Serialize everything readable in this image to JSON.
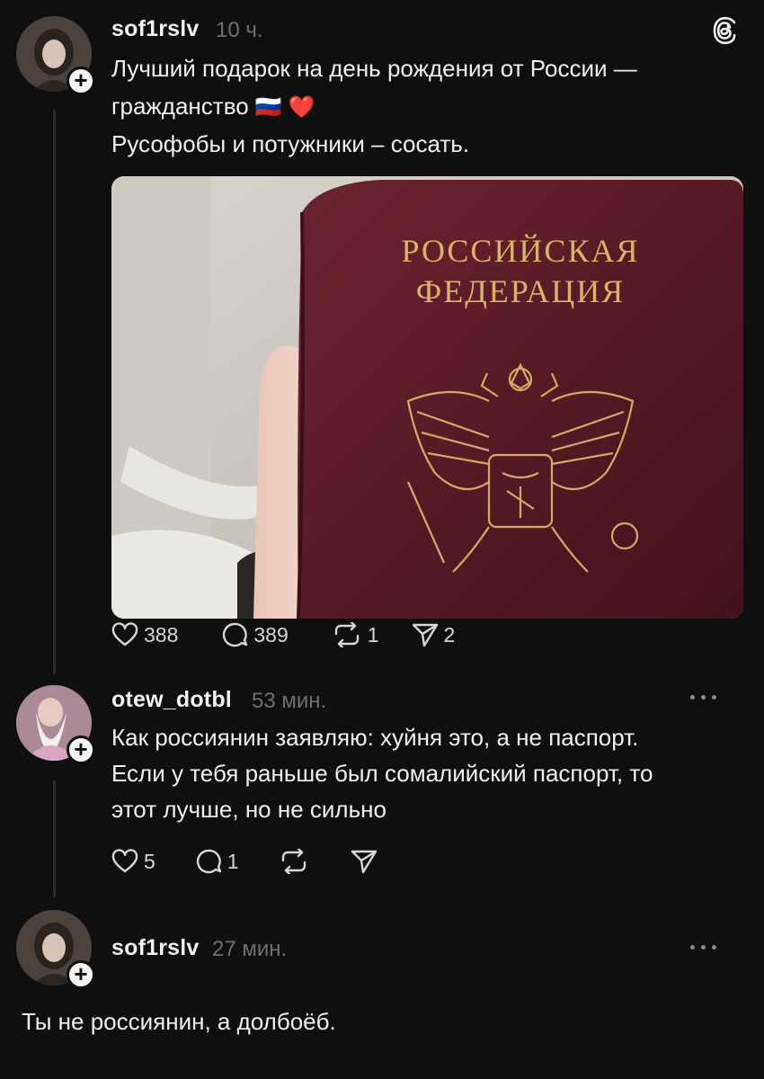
{
  "post": {
    "username": "sof1rslv",
    "time": "10 ч.",
    "line1": "Лучший подарок на день рождения от России —",
    "line2": "гражданство",
    "line2_emoji": "🇷🇺 ❤️",
    "line3": "Русофобы и потужники – сосать.",
    "image": {
      "title_line1": "РОССИЙСКАЯ",
      "title_line2": "ФЕДЕРАЦИЯ"
    },
    "stats": {
      "likes": "388",
      "comments": "389",
      "reposts": "1",
      "shares": "2"
    }
  },
  "reply1": {
    "username": "otew_dotbl",
    "time": "53 мин.",
    "line1": "Как россиянин заявляю: хуйня это, а не паспорт.",
    "line2": "Если у тебя раньше был сомалийский паспорт, то",
    "line3": "этот лучше, но не сильно",
    "stats": {
      "likes": "5",
      "comments": "1"
    }
  },
  "reply2": {
    "username": "sof1rslv",
    "time": "27 мин.",
    "text": "Ты не россиянин, а долбоёб."
  },
  "icons": {
    "app": "threads-icon",
    "like": "heart-icon",
    "comment": "comment-icon",
    "repost": "repost-icon",
    "share": "share-icon",
    "more": "more-icon",
    "follow": "plus-icon"
  },
  "colors": {
    "background": "#0f0f0f",
    "passport": "#5a1a24",
    "gold": "#d9b36a",
    "muted": "#6f6f6f"
  }
}
